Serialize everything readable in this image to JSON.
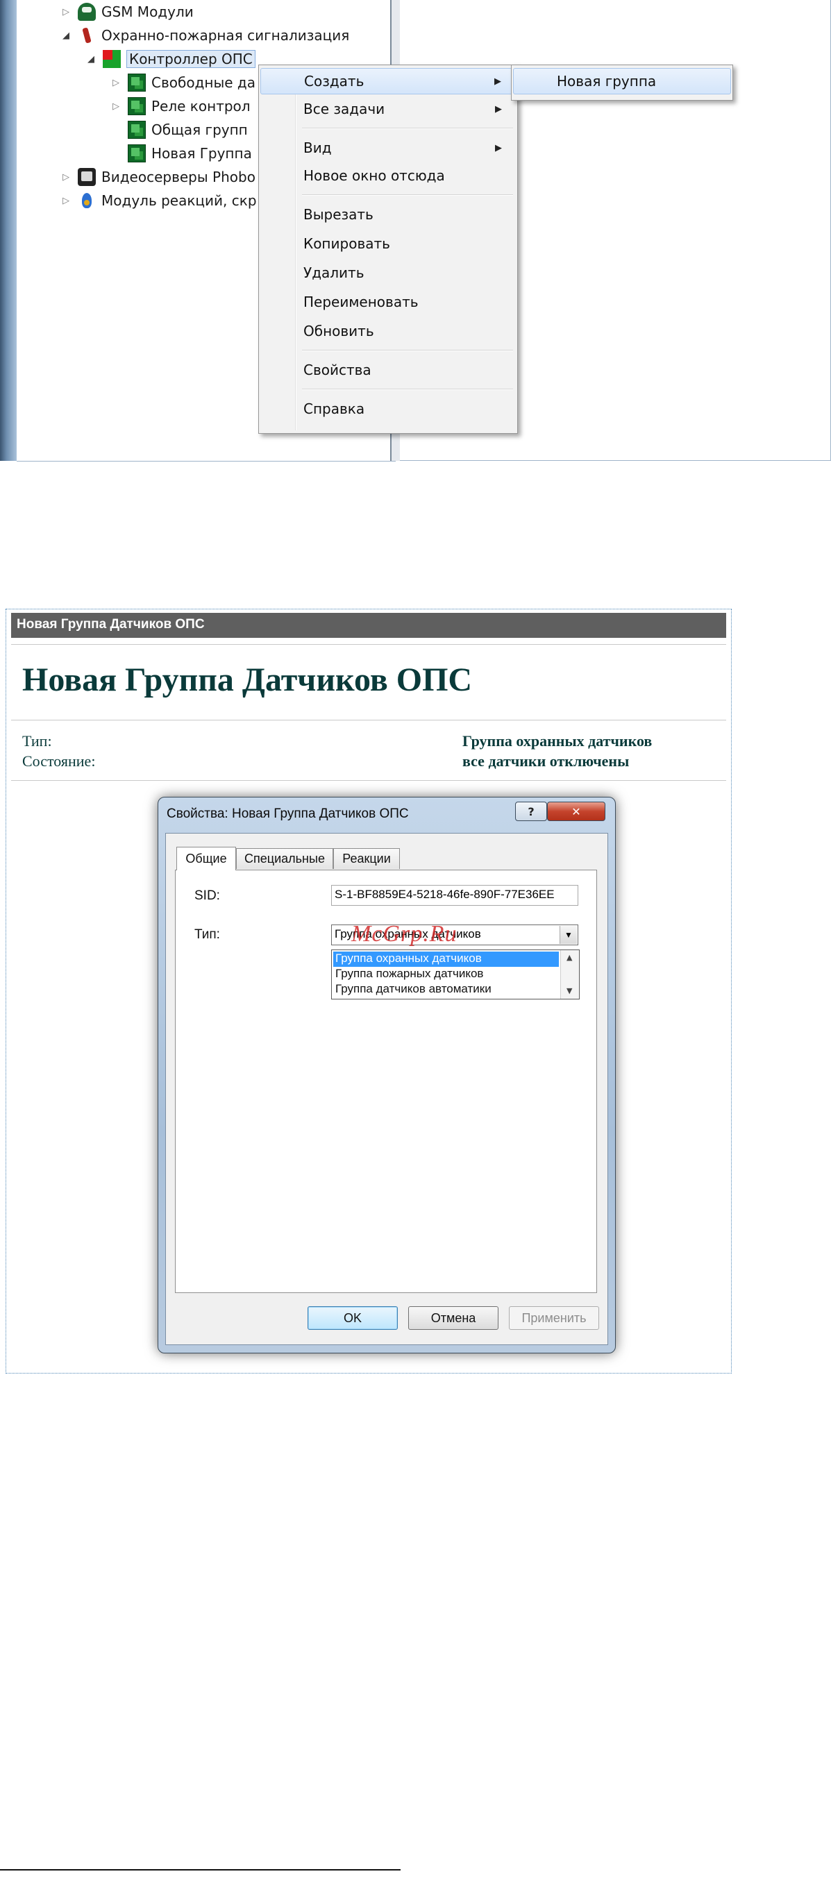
{
  "tree": {
    "items": [
      {
        "label": "GSM Модули",
        "icon": "gsm-module-icon"
      },
      {
        "label": "Охранно-пожарная сигнализация",
        "icon": "fire-alarm-icon"
      },
      {
        "label": "Контроллер ОПС",
        "icon": "controller-icon"
      },
      {
        "label": "Свободные да",
        "icon": "sensor-group-icon"
      },
      {
        "label": "Реле контрол",
        "icon": "sensor-group-icon"
      },
      {
        "label": "Общая групп",
        "icon": "sensor-group-icon"
      },
      {
        "label": "Новая Группа",
        "icon": "sensor-group-icon"
      },
      {
        "label": "Видеосерверы Phobo",
        "icon": "video-server-icon"
      },
      {
        "label": "Модуль реакций, скр",
        "icon": "reaction-module-icon"
      }
    ]
  },
  "context_menu": {
    "items": [
      {
        "label": "Создать",
        "submenu": true
      },
      {
        "label": "Все задачи",
        "submenu": true
      },
      {
        "label": "Вид",
        "submenu": true
      },
      {
        "label": "Новое окно отсюда"
      },
      {
        "label": "Вырезать"
      },
      {
        "label": "Копировать"
      },
      {
        "label": "Удалить"
      },
      {
        "label": "Переименовать"
      },
      {
        "label": "Обновить"
      },
      {
        "label": "Свойства"
      },
      {
        "label": "Справка"
      }
    ],
    "submenu_item": "Новая группа"
  },
  "doc": {
    "titlebar": "Новая Группа Датчиков ОПС",
    "heading": "Новая Группа Датчиков ОПС",
    "type_label": "Тип:",
    "type_value": "Группа охранных датчиков",
    "state_label": "Состояние:",
    "state_value": "все датчики отключены"
  },
  "dialog": {
    "title": "Свойства: Новая Группа Датчиков ОПС",
    "help_glyph": "?",
    "close_glyph": "✕",
    "tabs": [
      "Общие",
      "Специальные",
      "Реакции"
    ],
    "sid_label": "SID:",
    "sid_value": "S-1-BF8859E4-5218-46fe-890F-77E36EE",
    "type_label": "Тип:",
    "type_value": "Группа охранных датчиков",
    "type_options": [
      "Группа охранных датчиков",
      "Группа пожарных датчиков",
      "Группа датчиков автоматики"
    ],
    "ok_label": "OK",
    "cancel_label": "Отмена",
    "apply_label": "Применить"
  },
  "watermark": "McGrp.Ru",
  "colors": {
    "selection": "#3399ff",
    "doc_text": "#0a3a3a",
    "titlebar": "#5f5f5f"
  }
}
